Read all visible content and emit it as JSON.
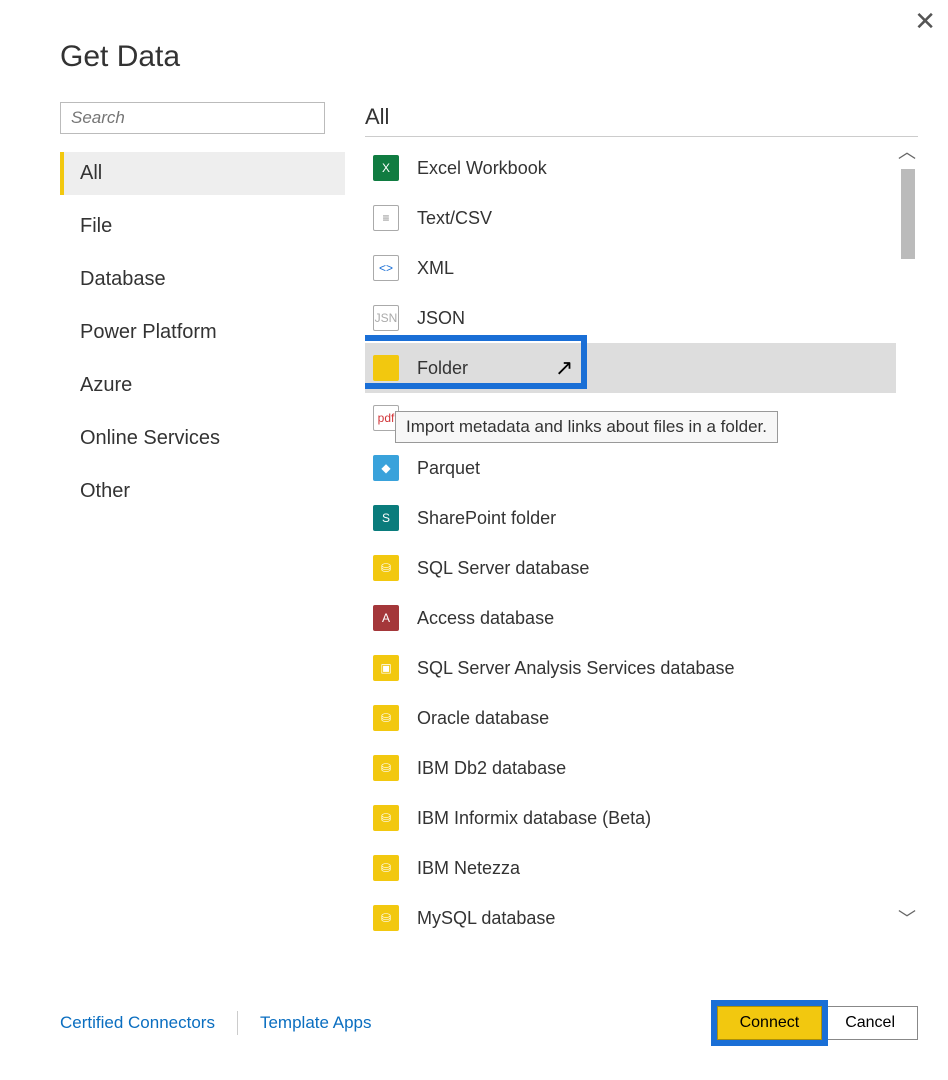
{
  "dialog": {
    "title": "Get Data",
    "search_placeholder": "Search",
    "categories": [
      {
        "label": "All",
        "selected": true
      },
      {
        "label": "File",
        "selected": false
      },
      {
        "label": "Database",
        "selected": false
      },
      {
        "label": "Power Platform",
        "selected": false
      },
      {
        "label": "Azure",
        "selected": false
      },
      {
        "label": "Online Services",
        "selected": false
      },
      {
        "label": "Other",
        "selected": false
      }
    ],
    "list_heading": "All",
    "connectors": [
      {
        "label": "Excel Workbook",
        "icon": "excel-icon",
        "icon_bg": "#107c41",
        "icon_fg": "#fff",
        "icon_char": "X",
        "selected": false
      },
      {
        "label": "Text/CSV",
        "icon": "text-icon",
        "icon_bg": "#fff",
        "icon_fg": "#888",
        "icon_char": "≡",
        "selected": false,
        "bordered": true
      },
      {
        "label": "XML",
        "icon": "xml-icon",
        "icon_bg": "#fff",
        "icon_fg": "#1a6fd6",
        "icon_char": "<>",
        "selected": false,
        "bordered": true
      },
      {
        "label": "JSON",
        "icon": "json-icon",
        "icon_bg": "#fff",
        "icon_fg": "#aaa",
        "icon_char": "JSN",
        "selected": false,
        "bordered": true
      },
      {
        "label": "Folder",
        "icon": "folder-icon",
        "icon_bg": "#f2c80f",
        "icon_fg": "#f2c80f",
        "icon_char": "",
        "selected": true
      },
      {
        "label": "PDF",
        "icon": "pdf-icon",
        "icon_bg": "#fff",
        "icon_fg": "#d13438",
        "icon_char": "pdf",
        "selected": false,
        "bordered": true
      },
      {
        "label": "Parquet",
        "icon": "parquet-icon",
        "icon_bg": "#39a2db",
        "icon_fg": "#fff",
        "icon_char": "◆",
        "selected": false
      },
      {
        "label": "SharePoint folder",
        "icon": "sharepoint-icon",
        "icon_bg": "#0a7c7c",
        "icon_fg": "#fff",
        "icon_char": "S",
        "selected": false
      },
      {
        "label": "SQL Server database",
        "icon": "database-icon",
        "icon_bg": "#f2c80f",
        "icon_fg": "#fff",
        "icon_char": "⛁",
        "selected": false
      },
      {
        "label": "Access database",
        "icon": "access-icon",
        "icon_bg": "#a4373a",
        "icon_fg": "#fff",
        "icon_char": "A",
        "selected": false
      },
      {
        "label": "SQL Server Analysis Services database",
        "icon": "cube-icon",
        "icon_bg": "#f2c80f",
        "icon_fg": "#fff",
        "icon_char": "▣",
        "selected": false
      },
      {
        "label": "Oracle database",
        "icon": "database-icon",
        "icon_bg": "#f2c80f",
        "icon_fg": "#fff",
        "icon_char": "⛁",
        "selected": false
      },
      {
        "label": "IBM Db2 database",
        "icon": "database-icon",
        "icon_bg": "#f2c80f",
        "icon_fg": "#fff",
        "icon_char": "⛁",
        "selected": false
      },
      {
        "label": "IBM Informix database (Beta)",
        "icon": "database-icon",
        "icon_bg": "#f2c80f",
        "icon_fg": "#fff",
        "icon_char": "⛁",
        "selected": false
      },
      {
        "label": "IBM Netezza",
        "icon": "database-icon",
        "icon_bg": "#f2c80f",
        "icon_fg": "#fff",
        "icon_char": "⛁",
        "selected": false
      },
      {
        "label": "MySQL database",
        "icon": "database-icon",
        "icon_bg": "#f2c80f",
        "icon_fg": "#fff",
        "icon_char": "⛁",
        "selected": false
      }
    ],
    "tooltip": "Import metadata and links about files in a folder.",
    "footer": {
      "certified": "Certified Connectors",
      "templates": "Template Apps",
      "connect": "Connect",
      "cancel": "Cancel"
    }
  }
}
